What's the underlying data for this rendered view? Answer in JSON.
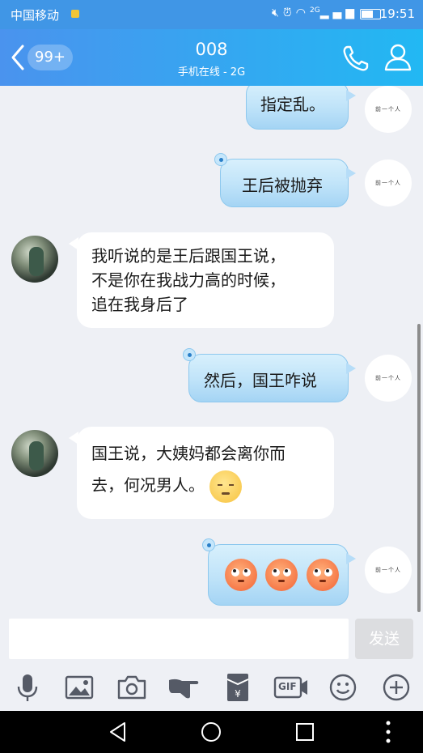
{
  "status_bar": {
    "carrier": "中国移动",
    "signal_text": "2G",
    "time": "19:51"
  },
  "header": {
    "back_label": "back",
    "unread_count": "99+",
    "contact_name": "008",
    "contact_status": "手机在线 - 2G"
  },
  "self_avatar_text": "前一个人",
  "messages": [
    {
      "direction": "out",
      "text": "指定乱。"
    },
    {
      "direction": "out",
      "text": "王后被抛弃"
    },
    {
      "direction": "in",
      "lines": [
        "我听说的是王后跟国王说，",
        "不是你在我战力高的时候，",
        "追在我身后了"
      ]
    },
    {
      "direction": "out",
      "text": "然后，国王咋说"
    },
    {
      "direction": "in",
      "lines": [
        "国王说，大姨妈都会离你而",
        "去，何况男人。"
      ],
      "emoji": "pensive-face-emoji"
    },
    {
      "direction": "out",
      "emojis": [
        "eye-roll-emoji",
        "eye-roll-emoji",
        "eye-roll-emoji"
      ]
    }
  ],
  "input": {
    "placeholder": "",
    "send_label": "发送"
  },
  "toolbar": {
    "items": [
      "microphone-icon",
      "image-icon",
      "camera-icon",
      "poke-hand-icon",
      "red-packet-icon",
      "gif-icon",
      "emoji-icon",
      "plus-icon"
    ],
    "gif_label": "GIF"
  },
  "nav_bar": {
    "items": [
      "back-triangle-icon",
      "home-circle-icon",
      "recents-square-icon",
      "more-dots-icon"
    ]
  },
  "colors": {
    "header_gradient_start": "#4a93ee",
    "header_gradient_end": "#22b8f3",
    "outgoing_bubble": "#bfe3f9",
    "chat_background": "#eef0f5"
  }
}
